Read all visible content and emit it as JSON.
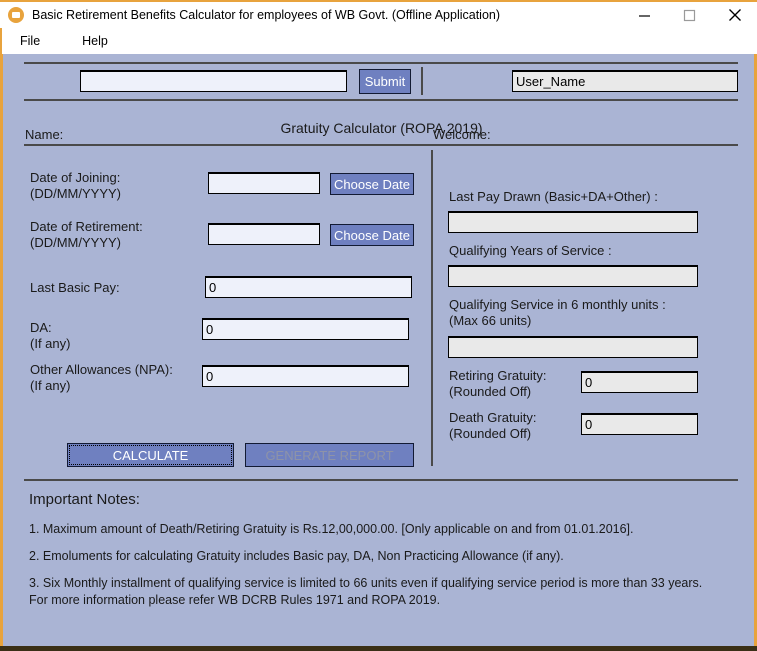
{
  "window": {
    "title": "Basic Retirement Benefits Calculator for employees of WB Govt. (Offline Application)",
    "icon": "app-window-icon",
    "controls": {
      "minimize": "minimize-icon",
      "maximize": "maximize-icon",
      "close": "close-icon"
    },
    "accent_border": "#e8a33d",
    "client_background": "#aab4d4"
  },
  "menu": {
    "items": [
      {
        "label": "File"
      },
      {
        "label": "Help"
      }
    ]
  },
  "user_bar": {
    "name_label": "Name:",
    "name_value": "",
    "name_placeholder": "",
    "submit_label": "Submit",
    "welcome_label": "Welcome:",
    "welcome_value": "User_Name"
  },
  "section": {
    "title": "Gratuity Calculator (ROPA 2019)"
  },
  "left_form": {
    "fields": [
      {
        "label": "Date of Joining:\n(DD/MM/YYYY)",
        "value": "",
        "button": "Choose Date"
      },
      {
        "label": "Date of Retirement:\n(DD/MM/YYYY)",
        "value": "",
        "button": "Choose Date"
      },
      {
        "label": "Last Basic Pay:",
        "value": "0"
      },
      {
        "label": "DA:\n(If any)",
        "value": "0"
      },
      {
        "label": "Other Allowances (NPA):\n(If any)",
        "value": "0"
      }
    ],
    "calculate_label": "CALCULATE",
    "generate_report_label": "GENERATE REPORT"
  },
  "right_form": {
    "fields": [
      {
        "label": "Last Pay Drawn (Basic+DA+Other) :",
        "value": ""
      },
      {
        "label": "Qualifying Years of Service :",
        "value": ""
      },
      {
        "label": "Qualifying Service in 6 monthly units :\n(Max 66 units)",
        "value": ""
      },
      {
        "label": "Retiring Gratuity:\n(Rounded Off)",
        "value": "0"
      },
      {
        "label": "Death Gratuity:\n(Rounded Off)",
        "value": "0"
      }
    ]
  },
  "notes": {
    "title": "Important Notes:",
    "items": [
      "1. Maximum amount of Death/Retiring Gratuity is Rs.12,00,000.00. [Only applicable on and from 01.01.2016].",
      "2. Emoluments for calculating Gratuity includes Basic pay, DA, Non Practicing Allowance (if any).",
      "3. Six Monthly installment of qualifying service is limited to 66 units even if qualifying service period is more than 33 years.\n    For more information please refer WB DCRB Rules 1971 and ROPA 2019."
    ]
  }
}
